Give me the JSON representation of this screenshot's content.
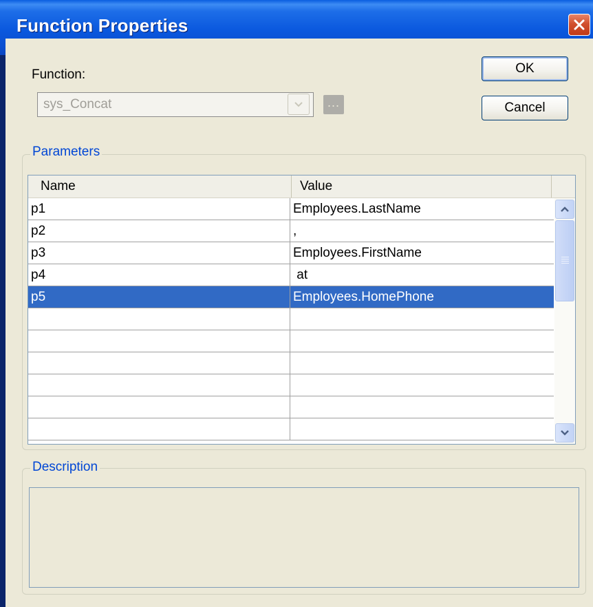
{
  "window": {
    "title": "Function Properties"
  },
  "function": {
    "label": "Function:",
    "value": "sys_Concat",
    "browse_label": "..."
  },
  "buttons": {
    "ok": "OK",
    "cancel": "Cancel"
  },
  "parameters": {
    "group_title": "Parameters",
    "columns": [
      "Name",
      "Value"
    ],
    "rows": [
      {
        "name": "p1",
        "value": "Employees.LastName"
      },
      {
        "name": "p2",
        "value": ","
      },
      {
        "name": "p3",
        "value": "Employees.FirstName"
      },
      {
        "name": "p4",
        "value": " at"
      },
      {
        "name": "p5",
        "value": "Employees.HomePhone",
        "selected": true
      },
      {
        "name": "",
        "value": ""
      },
      {
        "name": "",
        "value": ""
      },
      {
        "name": "",
        "value": ""
      },
      {
        "name": "",
        "value": ""
      },
      {
        "name": "",
        "value": ""
      },
      {
        "name": "",
        "value": ""
      }
    ]
  },
  "description": {
    "group_title": "Description",
    "text": ""
  },
  "colors": {
    "titlebar": "#0a58de",
    "selection": "#316ac5",
    "dialog_bg": "#ece9d8",
    "group_title": "#0046d5"
  },
  "icons": [
    "close-icon",
    "chevron-down-icon",
    "chevron-up-icon"
  ]
}
